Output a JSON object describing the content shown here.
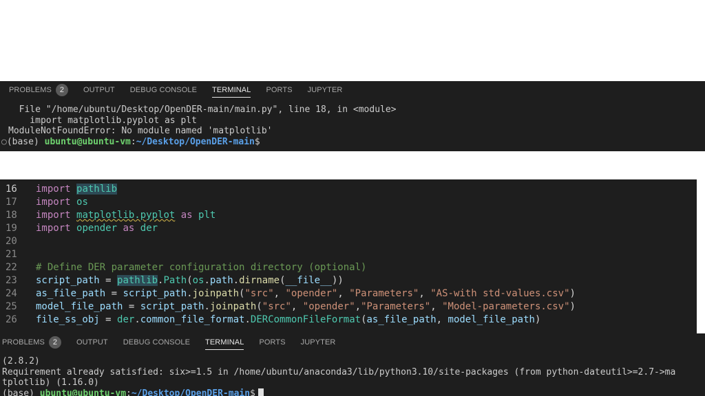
{
  "panel1": {
    "tabs": [
      "PROBLEMS",
      "OUTPUT",
      "DEBUG CONSOLE",
      "TERMINAL",
      "PORTS",
      "JUPYTER"
    ],
    "problems_count": "2",
    "active_tab": "TERMINAL",
    "lines": [
      "  File \"/home/ubuntu/Desktop/OpenDER-main/main.py\", line 18, in <module>",
      "    import matplotlib.pyplot as plt",
      "ModuleNotFoundError: No module named 'matplotlib'"
    ],
    "prompt": {
      "marker": "○",
      "env": "(base) ",
      "user": "ubuntu@ubuntu-vm",
      "sep": ":",
      "path": "~/Desktop/OpenDER-main",
      "dollar": "$"
    }
  },
  "editor": {
    "lines": [
      {
        "n": "16",
        "tokens": [
          [
            "kw",
            "import"
          ],
          [
            "plain",
            " "
          ],
          [
            "mod",
            "pathlib"
          ]
        ]
      },
      {
        "n": "17",
        "tokens": [
          [
            "kw",
            "import"
          ],
          [
            "plain",
            " "
          ],
          [
            "mod",
            "os"
          ]
        ]
      },
      {
        "n": "18",
        "tokens": [
          [
            "kw",
            "import"
          ],
          [
            "plain",
            " "
          ],
          [
            "mod",
            "matplotlib.pyplot"
          ],
          [
            "plain",
            " "
          ],
          [
            "kw",
            "as"
          ],
          [
            "plain",
            " "
          ],
          [
            "mod",
            "plt"
          ]
        ]
      },
      {
        "n": "19",
        "tokens": [
          [
            "kw",
            "import"
          ],
          [
            "plain",
            " "
          ],
          [
            "mod",
            "opender"
          ],
          [
            "plain",
            " "
          ],
          [
            "kw",
            "as"
          ],
          [
            "plain",
            " "
          ],
          [
            "mod",
            "der"
          ]
        ]
      },
      {
        "n": "20",
        "tokens": []
      },
      {
        "n": "21",
        "tokens": []
      },
      {
        "n": "22",
        "tokens": [
          [
            "cm",
            "# Define DER parameter configuration directory (optional)"
          ]
        ]
      },
      {
        "n": "23",
        "tokens": [
          [
            "var",
            "script_path"
          ],
          [
            "plain",
            " = "
          ],
          [
            "mod",
            "pathlib"
          ],
          [
            "plain",
            "."
          ],
          [
            "mod",
            "Path"
          ],
          [
            "plain",
            "("
          ],
          [
            "mod",
            "os"
          ],
          [
            "plain",
            "."
          ],
          [
            "var",
            "path"
          ],
          [
            "plain",
            "."
          ],
          [
            "fn",
            "dirname"
          ],
          [
            "plain",
            "("
          ],
          [
            "var",
            "__file__"
          ],
          [
            "plain",
            "))"
          ]
        ]
      },
      {
        "n": "24",
        "tokens": [
          [
            "var",
            "as_file_path"
          ],
          [
            "plain",
            " = "
          ],
          [
            "var",
            "script_path"
          ],
          [
            "plain",
            "."
          ],
          [
            "fn",
            "joinpath"
          ],
          [
            "plain",
            "("
          ],
          [
            "str",
            "\"src\""
          ],
          [
            "plain",
            ", "
          ],
          [
            "str",
            "\"opender\""
          ],
          [
            "plain",
            ", "
          ],
          [
            "str",
            "\"Parameters\""
          ],
          [
            "plain",
            ", "
          ],
          [
            "str",
            "\"AS-with std-values.csv\""
          ],
          [
            "plain",
            ")"
          ]
        ]
      },
      {
        "n": "25",
        "tokens": [
          [
            "var",
            "model_file_path"
          ],
          [
            "plain",
            " = "
          ],
          [
            "var",
            "script_path"
          ],
          [
            "plain",
            "."
          ],
          [
            "fn",
            "joinpath"
          ],
          [
            "plain",
            "("
          ],
          [
            "str",
            "\"src\""
          ],
          [
            "plain",
            ", "
          ],
          [
            "str",
            "\"opender\""
          ],
          [
            "plain",
            ","
          ],
          [
            "str",
            "\"Parameters\""
          ],
          [
            "plain",
            ", "
          ],
          [
            "str",
            "\"Model-parameters.csv\""
          ],
          [
            "plain",
            ")"
          ]
        ]
      },
      {
        "n": "26",
        "tokens": [
          [
            "var",
            "file_ss_obj"
          ],
          [
            "plain",
            " = "
          ],
          [
            "mod",
            "der"
          ],
          [
            "plain",
            "."
          ],
          [
            "var",
            "common_file_format"
          ],
          [
            "plain",
            "."
          ],
          [
            "mod",
            "DERCommonFileFormat"
          ],
          [
            "plain",
            "("
          ],
          [
            "var",
            "as_file_path"
          ],
          [
            "plain",
            ", "
          ],
          [
            "var",
            "model_file_path"
          ],
          [
            "plain",
            ")"
          ]
        ]
      }
    ]
  },
  "panel2": {
    "tabs": [
      "PROBLEMS",
      "OUTPUT",
      "DEBUG CONSOLE",
      "TERMINAL",
      "PORTS",
      "JUPYTER"
    ],
    "problems_count": "2",
    "active_tab": "TERMINAL",
    "lines": [
      "(2.8.2)",
      "Requirement already satisfied: six>=1.5 in /home/ubuntu/anaconda3/lib/python3.10/site-packages (from python-dateutil>=2.7->ma",
      "tplotlib) (1.16.0)"
    ],
    "prompt": {
      "env": "(base) ",
      "user": "ubuntu@ubuntu-vm",
      "sep": ":",
      "path": "~/Desktop/OpenDER-main",
      "dollar": "$"
    }
  }
}
